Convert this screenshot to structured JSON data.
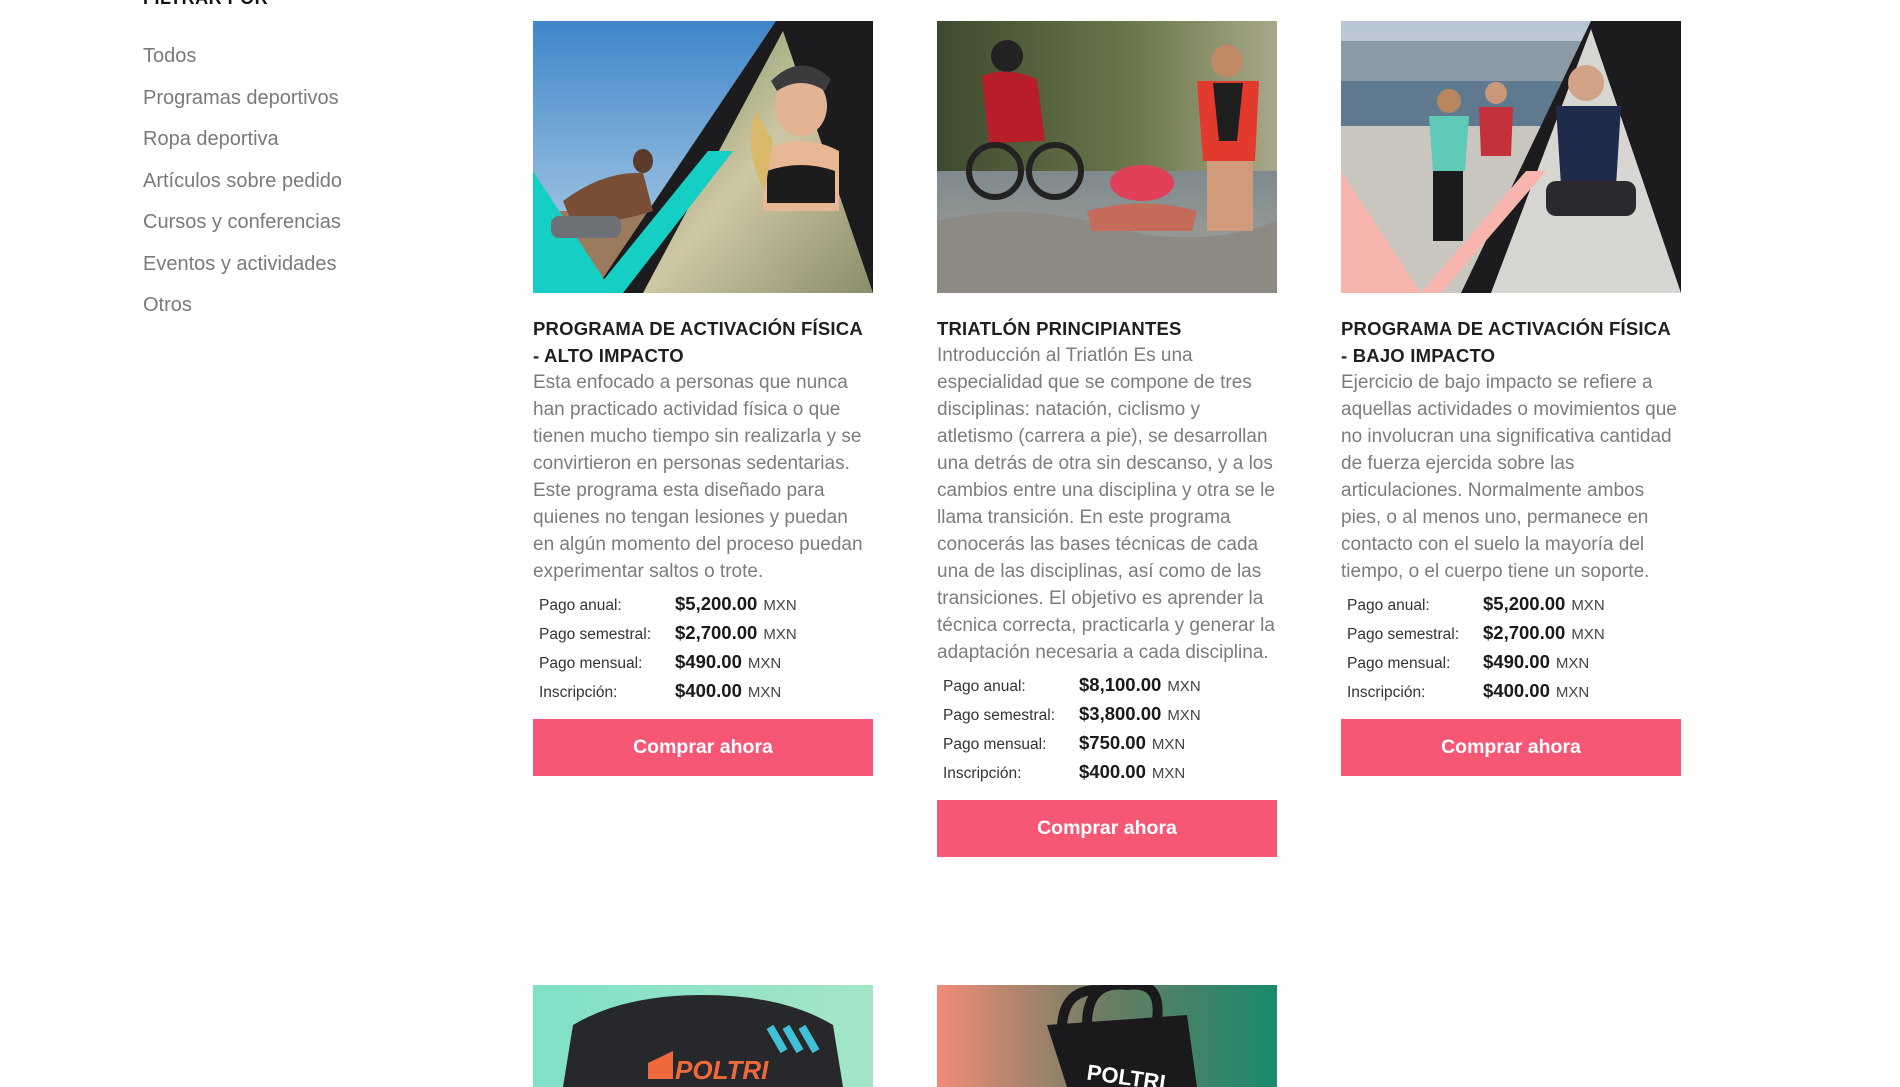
{
  "sidebar": {
    "title": "FILTRAR POR",
    "items": [
      {
        "label": "Todos"
      },
      {
        "label": "Programas deportivos"
      },
      {
        "label": "Ropa deportiva"
      },
      {
        "label": "Artículos sobre pedido"
      },
      {
        "label": "Cursos y conferencias"
      },
      {
        "label": "Eventos y actividades"
      },
      {
        "label": "Otros"
      }
    ]
  },
  "cards": [
    {
      "title": "PROGRAMA DE ACTIVACIÓN FÍSICA - ALTO IMPACTO",
      "description": "Esta enfocado a personas que nunca han practicado actividad física o que tienen mucho tiempo sin realizarla y se convirtieron en personas sedentarias. Este programa esta diseñado para quienes no tengan lesiones y puedan en algún momento del proceso puedan experimentar saltos o trote.",
      "accent_color": "#16cfc4",
      "prices": [
        {
          "label": "Pago anual:",
          "amount": "$5,200.00",
          "currency": "MXN"
        },
        {
          "label": "Pago semestral:",
          "amount": "$2,700.00",
          "currency": "MXN"
        },
        {
          "label": "Pago mensual:",
          "amount": "$490.00",
          "currency": "MXN"
        },
        {
          "label": "Inscripción:",
          "amount": "$400.00",
          "currency": "MXN"
        }
      ],
      "button_label": "Comprar ahora"
    },
    {
      "title": "TRIATLÓN PRINCIPIANTES",
      "description": "Introducción al Triatlón Es una especialidad que se compone de tres disciplinas: natación, ciclismo y atletismo (carrera a pie), se desarrollan una detrás de otra sin descanso, y a los cambios entre una disciplina y otra se le llama transición. En este programa conocerás las bases técnicas de cada una de las disciplinas, así como de las transiciones. El objetivo es aprender la técnica correcta, practicarla y generar la adaptación necesaria a cada disciplina.",
      "prices": [
        {
          "label": "Pago anual:",
          "amount": "$8,100.00",
          "currency": "MXN"
        },
        {
          "label": "Pago semestral:",
          "amount": "$3,800.00",
          "currency": "MXN"
        },
        {
          "label": "Pago mensual:",
          "amount": "$750.00",
          "currency": "MXN"
        },
        {
          "label": "Inscripción:",
          "amount": "$400.00",
          "currency": "MXN"
        }
      ],
      "button_label": "Comprar ahora"
    },
    {
      "title": "PROGRAMA DE ACTIVACIÓN FÍSICA - BAJO IMPACTO",
      "description": "Ejercicio de bajo impacto se refiere a aquellas actividades o movimientos que no involucran una significativa cantidad de fuerza ejercida sobre las articulaciones. Normalmente ambos pies, o al menos uno, permanece en contacto con el suelo la mayoría del tiempo, o el cuerpo tiene un soporte.",
      "accent_color": "#f8b5ad",
      "prices": [
        {
          "label": "Pago anual:",
          "amount": "$5,200.00",
          "currency": "MXN"
        },
        {
          "label": "Pago semestral:",
          "amount": "$2,700.00",
          "currency": "MXN"
        },
        {
          "label": "Pago mensual:",
          "amount": "$490.00",
          "currency": "MXN"
        },
        {
          "label": "Inscripción:",
          "amount": "$400.00",
          "currency": "MXN"
        }
      ],
      "button_label": "Comprar ahora"
    }
  ],
  "bottom_products": [
    {
      "image_text": "POLTRI"
    },
    {
      "image_text": "POLTRI"
    }
  ],
  "colors": {
    "button": "#f55775",
    "description_text": "#7c7c7c",
    "sidebar_text": "#7a7a7a"
  }
}
